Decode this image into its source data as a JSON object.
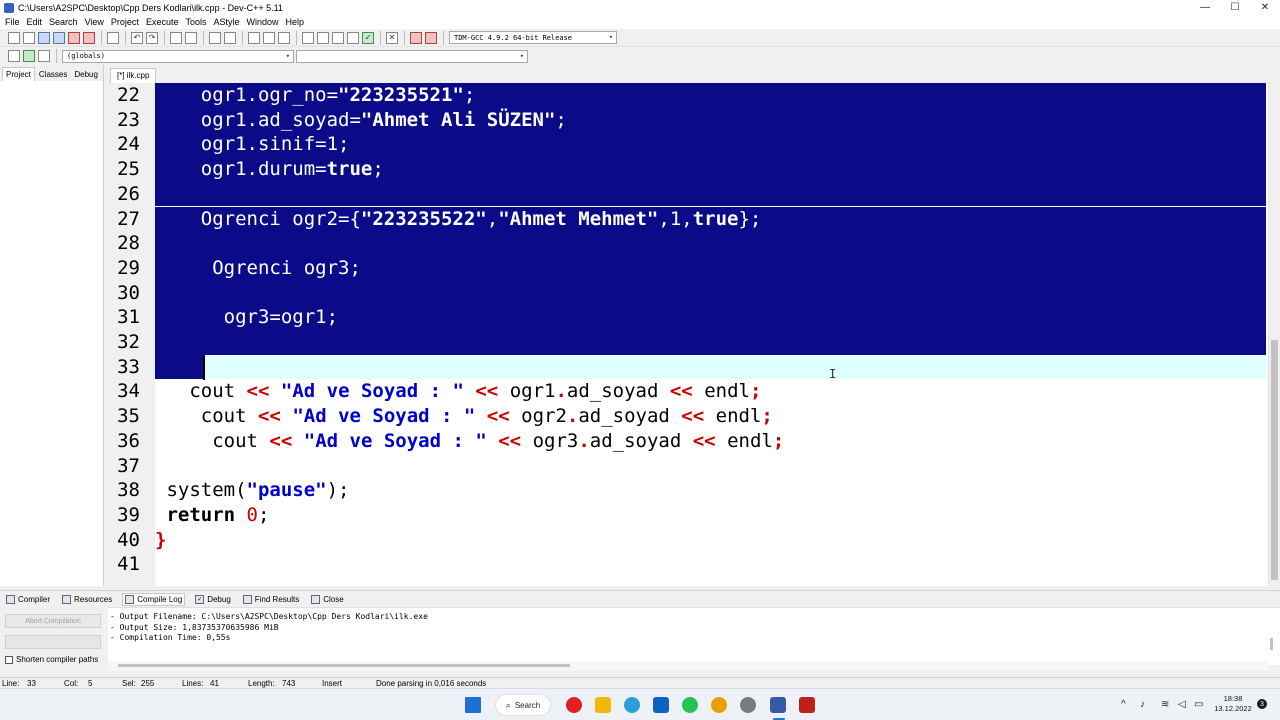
{
  "window": {
    "title": "C:\\Users\\A2SPC\\Desktop\\Cpp Ders Kodlari\\ilk.cpp - Dev-C++ 5.11",
    "minimize": "—",
    "maximize": "☐",
    "close": "✕"
  },
  "menu": [
    "File",
    "Edit",
    "Search",
    "View",
    "Project",
    "Execute",
    "Tools",
    "AStyle",
    "Window",
    "Help"
  ],
  "toolbar": {
    "compiler_select": "TDM-GCC 4.9.2 64-bit Release",
    "scope_select": "(globals)",
    "function_select": ""
  },
  "left_panel": {
    "tabs": [
      "Project",
      "Classes",
      "Debug"
    ],
    "active_tab": "Project"
  },
  "editor": {
    "tab_label": "[*] ilk.cpp",
    "lines": [
      {
        "num": "22",
        "selected": true,
        "indent": "    ",
        "tokens": [
          {
            "t": "ogr1.ogr_no=",
            "c": ""
          },
          {
            "t": "\"223235521\"",
            "c": "str"
          },
          {
            "t": ";",
            "c": ""
          }
        ]
      },
      {
        "num": "23",
        "selected": true,
        "indent": "    ",
        "tokens": [
          {
            "t": "ogr1.ad_soyad=",
            "c": ""
          },
          {
            "t": "\"Ahmet Ali SÜZEN\"",
            "c": "str"
          },
          {
            "t": ";",
            "c": ""
          }
        ]
      },
      {
        "num": "24",
        "selected": true,
        "indent": "    ",
        "tokens": [
          {
            "t": "ogr1.sinif=1;",
            "c": ""
          }
        ]
      },
      {
        "num": "25",
        "selected": true,
        "indent": "    ",
        "tokens": [
          {
            "t": "ogr1.durum=",
            "c": ""
          },
          {
            "t": "true",
            "c": "kw"
          },
          {
            "t": ";",
            "c": ""
          }
        ]
      },
      {
        "num": "26",
        "selected": true,
        "indent": "",
        "tokens": []
      },
      {
        "num": "27",
        "selected": true,
        "indent": "    ",
        "tokens": [
          {
            "t": "Ogrenci ogr2={",
            "c": ""
          },
          {
            "t": "\"223235522\"",
            "c": "str"
          },
          {
            "t": ",",
            "c": ""
          },
          {
            "t": "\"Ahmet Mehmet\"",
            "c": "str"
          },
          {
            "t": ",1,",
            "c": ""
          },
          {
            "t": "true",
            "c": "kw"
          },
          {
            "t": "};",
            "c": ""
          }
        ]
      },
      {
        "num": "28",
        "selected": true,
        "indent": "",
        "tokens": []
      },
      {
        "num": "29",
        "selected": true,
        "indent": "     ",
        "tokens": [
          {
            "t": "Ogrenci ogr3;",
            "c": ""
          }
        ]
      },
      {
        "num": "30",
        "selected": true,
        "indent": "",
        "tokens": []
      },
      {
        "num": "31",
        "selected": true,
        "indent": "      ",
        "tokens": [
          {
            "t": "ogr3=ogr1;",
            "c": ""
          }
        ]
      },
      {
        "num": "32",
        "selected": true,
        "indent": "",
        "tokens": []
      },
      {
        "num": "33",
        "selected": "partial",
        "indent": "",
        "tokens": []
      },
      {
        "num": "34",
        "selected": false,
        "indent": "   ",
        "tokens": [
          {
            "t": "cout ",
            "c": ""
          },
          {
            "t": "<<",
            "c": "op"
          },
          {
            "t": " ",
            "c": ""
          },
          {
            "t": "\"Ad ve Soyad : \"",
            "c": "str"
          },
          {
            "t": " ",
            "c": ""
          },
          {
            "t": "<<",
            "c": "op"
          },
          {
            "t": " ogr1",
            "c": ""
          },
          {
            "t": ".",
            "c": "op"
          },
          {
            "t": "ad_soyad ",
            "c": ""
          },
          {
            "t": "<<",
            "c": "op"
          },
          {
            "t": " endl",
            "c": ""
          },
          {
            "t": ";",
            "c": "op"
          }
        ]
      },
      {
        "num": "35",
        "selected": false,
        "indent": "    ",
        "tokens": [
          {
            "t": "cout ",
            "c": ""
          },
          {
            "t": "<<",
            "c": "op"
          },
          {
            "t": " ",
            "c": ""
          },
          {
            "t": "\"Ad ve Soyad : \"",
            "c": "str"
          },
          {
            "t": " ",
            "c": ""
          },
          {
            "t": "<<",
            "c": "op"
          },
          {
            "t": " ogr2",
            "c": ""
          },
          {
            "t": ".",
            "c": "op"
          },
          {
            "t": "ad_soyad ",
            "c": ""
          },
          {
            "t": "<<",
            "c": "op"
          },
          {
            "t": " endl",
            "c": ""
          },
          {
            "t": ";",
            "c": "op"
          }
        ]
      },
      {
        "num": "36",
        "selected": false,
        "indent": "     ",
        "tokens": [
          {
            "t": "cout ",
            "c": ""
          },
          {
            "t": "<<",
            "c": "op"
          },
          {
            "t": " ",
            "c": ""
          },
          {
            "t": "\"Ad ve Soyad : \"",
            "c": "str"
          },
          {
            "t": " ",
            "c": ""
          },
          {
            "t": "<<",
            "c": "op"
          },
          {
            "t": " ogr3",
            "c": ""
          },
          {
            "t": ".",
            "c": "op"
          },
          {
            "t": "ad_soyad ",
            "c": ""
          },
          {
            "t": "<<",
            "c": "op"
          },
          {
            "t": " endl",
            "c": ""
          },
          {
            "t": ";",
            "c": "op"
          }
        ]
      },
      {
        "num": "37",
        "selected": false,
        "indent": "",
        "tokens": []
      },
      {
        "num": "38",
        "selected": false,
        "indent": " ",
        "tokens": [
          {
            "t": "system(",
            "c": ""
          },
          {
            "t": "\"pause\"",
            "c": "str"
          },
          {
            "t": ");",
            "c": ""
          }
        ]
      },
      {
        "num": "39",
        "selected": false,
        "indent": " ",
        "tokens": [
          {
            "t": "return",
            "c": "kw"
          },
          {
            "t": " ",
            "c": ""
          },
          {
            "t": "0",
            "c": "num"
          },
          {
            "t": ";",
            "c": ""
          }
        ]
      },
      {
        "num": "40",
        "selected": false,
        "indent": "",
        "tokens": [
          {
            "t": "}",
            "c": "op"
          }
        ]
      },
      {
        "num": "41",
        "selected": false,
        "indent": "",
        "tokens": []
      }
    ]
  },
  "bottom_panel": {
    "tabs": [
      "Compiler",
      "Resources",
      "Compile Log",
      "Debug",
      "Find Results",
      "Close"
    ],
    "active_tab": "Compile Log",
    "abort_button": "Abort Compilation",
    "shorten_paths_label": "Shorten compiler paths",
    "log_lines": [
      "- Output Filename: C:\\Users\\A2SPC\\Desktop\\Cpp Ders Kodlari\\ilk.exe",
      "- Output Size: 1,83735370635986 MiB",
      "- Compilation Time: 0,55s"
    ]
  },
  "status": {
    "line": "Line:",
    "line_val": "33",
    "col": "Col:",
    "col_val": "5",
    "sel": "Sel:",
    "sel_val": "255",
    "lines": "Lines:",
    "lines_val": "41",
    "length": "Length:",
    "length_val": "743",
    "mode": "Insert",
    "message": "Done parsing in 0,016 seconds"
  },
  "taskbar": {
    "search_label": "Search",
    "time": "18:38",
    "date": "13.12.2022",
    "notification_count": "3"
  }
}
